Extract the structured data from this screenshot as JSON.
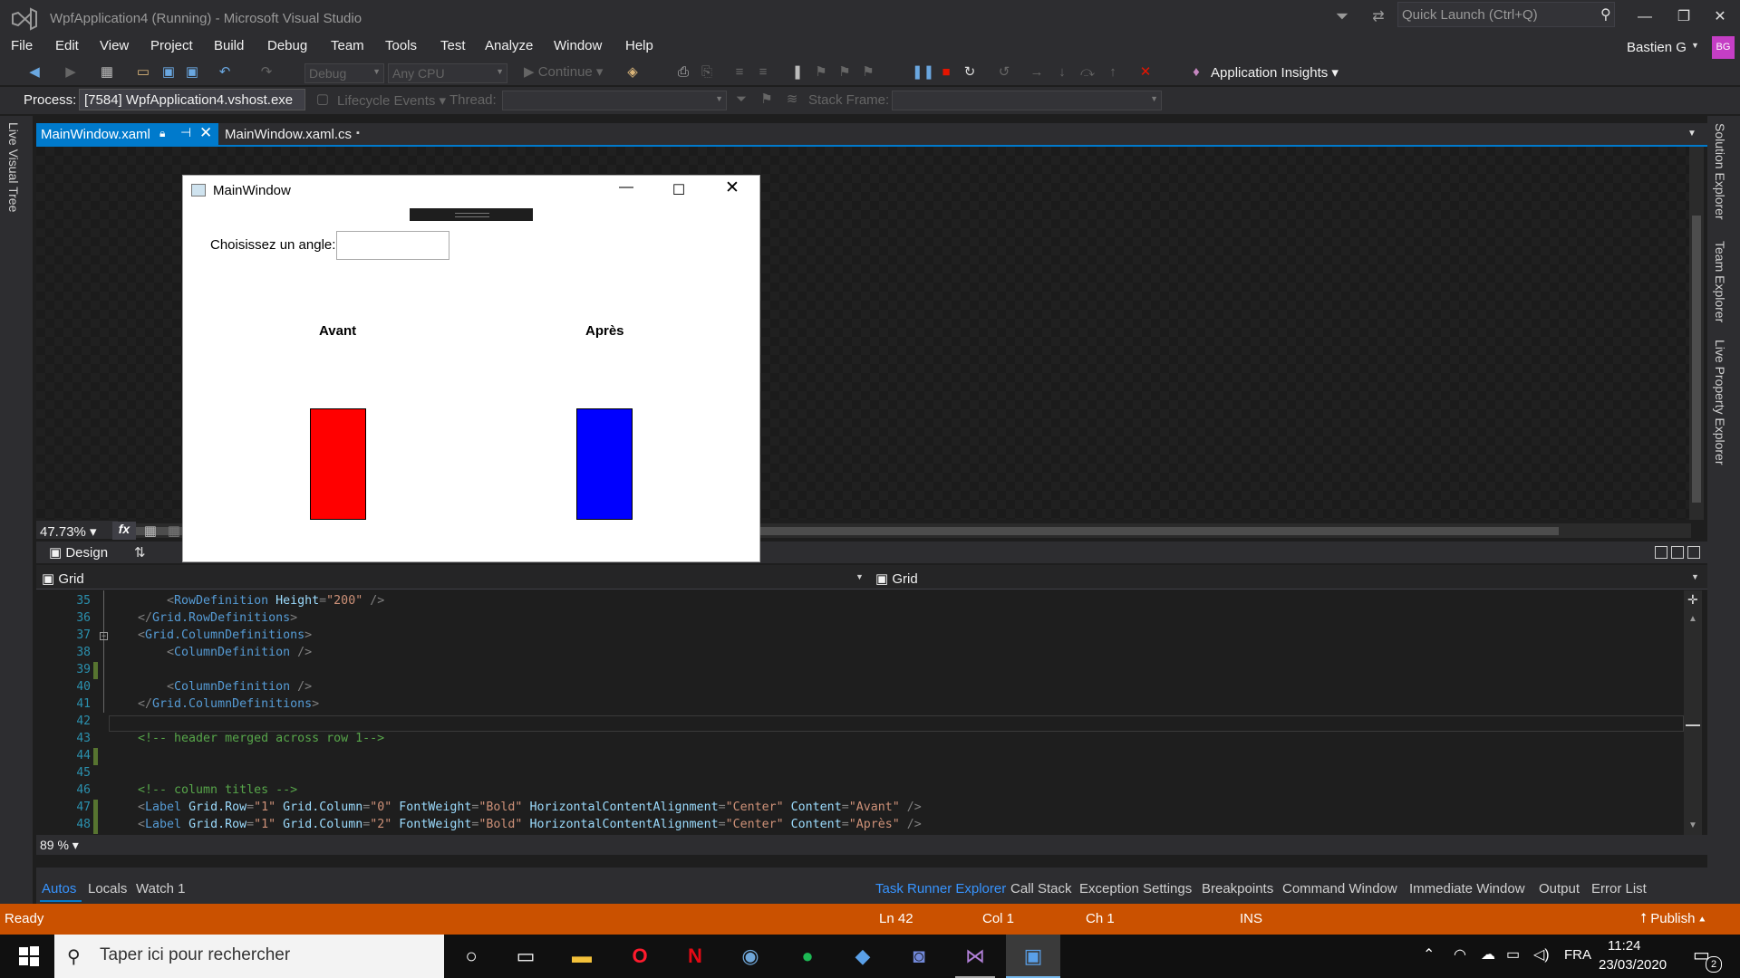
{
  "window": {
    "title": "WpfApplication4 (Running) - Microsoft Visual Studio"
  },
  "quick_launch": {
    "placeholder": "Quick Launch (Ctrl+Q)"
  },
  "menu": [
    "File",
    "Edit",
    "View",
    "Project",
    "Build",
    "Debug",
    "Team",
    "Tools",
    "Test",
    "Analyze",
    "Window",
    "Help"
  ],
  "user": {
    "name": "Bastien G",
    "initials": "BG"
  },
  "toolbar": {
    "config": "Debug",
    "platform": "Any CPU",
    "continue_label": "Continue",
    "app_insights": "Application Insights"
  },
  "debug_location": {
    "process_label": "Process:",
    "process_value": "[7584] WpfApplication4.vshost.exe",
    "lifecycle_label": "Lifecycle Events",
    "thread_label": "Thread:",
    "stack_frame_label": "Stack Frame:"
  },
  "left_rail": {
    "live_visual_tree": "Live Visual Tree"
  },
  "right_rail": [
    "Solution Explorer",
    "Team Explorer",
    "Live Property Explorer"
  ],
  "tabs": [
    {
      "label": "MainWindow.xaml",
      "active": true
    },
    {
      "label": "MainWindow.xaml.cs",
      "active": false
    }
  ],
  "designer": {
    "zoom": "47.73%",
    "fx": "fx",
    "design_tab": "Design"
  },
  "breadcrumb": {
    "left": "Grid",
    "right": "Grid"
  },
  "editor": {
    "lines": [
      {
        "n": "35",
        "parts": [
          [
            "br",
            "<"
          ],
          [
            "tag",
            "RowDefinition"
          ],
          [
            "txt",
            " "
          ],
          [
            "attr",
            "Height"
          ],
          [
            "br",
            "="
          ],
          [
            "val",
            "\"200\""
          ],
          [
            "txt",
            " "
          ],
          [
            "br",
            "/>"
          ]
        ],
        "indent": 2
      },
      {
        "n": "36",
        "parts": [
          [
            "br",
            "</"
          ],
          [
            "tag",
            "Grid.RowDefinitions"
          ],
          [
            "br",
            ">"
          ]
        ],
        "indent": 1
      },
      {
        "n": "37",
        "parts": [
          [
            "br",
            "<"
          ],
          [
            "tag",
            "Grid.ColumnDefinitions"
          ],
          [
            "br",
            ">"
          ]
        ],
        "indent": 1
      },
      {
        "n": "38",
        "parts": [
          [
            "br",
            "<"
          ],
          [
            "tag",
            "ColumnDefinition"
          ],
          [
            "txt",
            " "
          ],
          [
            "br",
            "/>"
          ]
        ],
        "indent": 2
      },
      {
        "n": "39",
        "parts": [],
        "indent": 0
      },
      {
        "n": "40",
        "parts": [
          [
            "br",
            "<"
          ],
          [
            "tag",
            "ColumnDefinition"
          ],
          [
            "txt",
            " "
          ],
          [
            "br",
            "/>"
          ]
        ],
        "indent": 2
      },
      {
        "n": "41",
        "parts": [
          [
            "br",
            "</"
          ],
          [
            "tag",
            "Grid.ColumnDefinitions"
          ],
          [
            "br",
            ">"
          ]
        ],
        "indent": 1
      },
      {
        "n": "42",
        "parts": [],
        "indent": 0
      },
      {
        "n": "43",
        "parts": [
          [
            "com",
            "<!-- header merged across row 1-->"
          ]
        ],
        "indent": 1
      },
      {
        "n": "44",
        "parts": [],
        "indent": 0
      },
      {
        "n": "45",
        "parts": [],
        "indent": 0
      },
      {
        "n": "46",
        "parts": [
          [
            "com",
            "<!-- column titles -->"
          ]
        ],
        "indent": 1
      },
      {
        "n": "47",
        "parts": [
          [
            "br",
            "<"
          ],
          [
            "tag",
            "Label"
          ],
          [
            "txt",
            " "
          ],
          [
            "attr",
            "Grid.Row"
          ],
          [
            "br",
            "="
          ],
          [
            "val",
            "\"1\""
          ],
          [
            "txt",
            " "
          ],
          [
            "attr",
            "Grid.Column"
          ],
          [
            "br",
            "="
          ],
          [
            "val",
            "\"0\""
          ],
          [
            "txt",
            " "
          ],
          [
            "attr",
            "FontWeight"
          ],
          [
            "br",
            "="
          ],
          [
            "val",
            "\"Bold\""
          ],
          [
            "txt",
            " "
          ],
          [
            "attr",
            "HorizontalContentAlignment"
          ],
          [
            "br",
            "="
          ],
          [
            "val",
            "\"Center\""
          ],
          [
            "txt",
            " "
          ],
          [
            "attr",
            "Content"
          ],
          [
            "br",
            "="
          ],
          [
            "val",
            "\"Avant\""
          ],
          [
            "txt",
            " "
          ],
          [
            "br",
            "/>"
          ]
        ],
        "indent": 1
      },
      {
        "n": "48",
        "parts": [
          [
            "br",
            "<"
          ],
          [
            "tag",
            "Label"
          ],
          [
            "txt",
            " "
          ],
          [
            "attr",
            "Grid.Row"
          ],
          [
            "br",
            "="
          ],
          [
            "val",
            "\"1\""
          ],
          [
            "txt",
            " "
          ],
          [
            "attr",
            "Grid.Column"
          ],
          [
            "br",
            "="
          ],
          [
            "val",
            "\"2\""
          ],
          [
            "txt",
            " "
          ],
          [
            "attr",
            "FontWeight"
          ],
          [
            "br",
            "="
          ],
          [
            "val",
            "\"Bold\""
          ],
          [
            "txt",
            " "
          ],
          [
            "attr",
            "HorizontalContentAlignment"
          ],
          [
            "br",
            "="
          ],
          [
            "val",
            "\"Center\""
          ],
          [
            "txt",
            " "
          ],
          [
            "attr",
            "Content"
          ],
          [
            "br",
            "="
          ],
          [
            "val",
            "\"Après\""
          ],
          [
            "txt",
            " "
          ],
          [
            "br",
            "/>"
          ]
        ],
        "indent": 1
      }
    ],
    "zoom": "89 %"
  },
  "bottom_tabs_left": [
    "Autos",
    "Locals",
    "Watch 1"
  ],
  "bottom_tabs_right": [
    "Task Runner Explorer",
    "Call Stack",
    "Exception Settings",
    "Breakpoints",
    "Command Window",
    "Immediate Window",
    "Output",
    "Error List"
  ],
  "status": {
    "state": "Ready",
    "ln": "Ln 42",
    "col": "Col 1",
    "ch": "Ch 1",
    "mode": "INS",
    "publish": "Publish"
  },
  "wpf_app": {
    "title": "MainWindow",
    "angle_label": "Choisissez un angle:",
    "angle_value": "",
    "before_label": "Avant",
    "after_label": "Après",
    "before_color": "#ff0000",
    "after_color": "#0000ff"
  },
  "taskbar": {
    "search_placeholder": "Taper ici pour rechercher",
    "apps": [
      "cortana-icon",
      "task-view-icon",
      "file-explorer-icon",
      "opera-icon",
      "netflix-icon",
      "steam-icon",
      "spotify-icon",
      "visual-studio-installer-icon",
      "discord-icon",
      "visual-studio-icon",
      "wpf-app-icon"
    ],
    "lang": "FRA",
    "time": "11:24",
    "date": "23/03/2020",
    "notifications": "2"
  },
  "colors": {
    "accent": "#007acc",
    "status_bar": "#ca5100",
    "chrome": "#2d2d30"
  }
}
